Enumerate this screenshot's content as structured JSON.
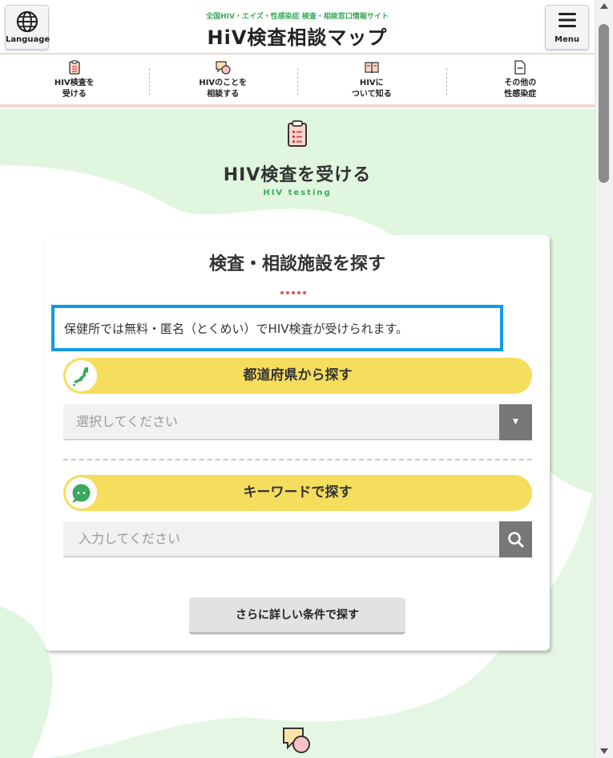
{
  "header": {
    "tagline": "全国HIV・エイズ・性感染症 検査・相談窓口情報サイト",
    "logo": "HiV検査相談マップ",
    "language_label": "Language",
    "menu_label": "Menu"
  },
  "nav": {
    "items": [
      {
        "label": "HIV検査を\n受ける",
        "icon": "clipboard-icon"
      },
      {
        "label": "HIVのことを\n相談する",
        "icon": "chat-bubble-icon"
      },
      {
        "label": "HIVに\nついて知る",
        "icon": "book-icon"
      },
      {
        "label": "その他の\n性感染症",
        "icon": "document-icon"
      }
    ]
  },
  "section": {
    "title": "HIV検査を受ける",
    "subtitle": "HIV testing"
  },
  "search": {
    "title": "検査・相談施設を探す",
    "notice": "保健所では無料・匿名（とくめい）でHIV検査が受けられます。",
    "by_prefecture_label": "都道府県から探す",
    "select_placeholder": "選択してください",
    "by_keyword_label": "キーワードで探す",
    "keyword_placeholder": "入力してください",
    "more_button": "さらに詳しい条件で探す"
  },
  "colors": {
    "accent_yellow": "#f5dd5e",
    "accent_green": "#3aa85d",
    "highlight_blue": "#109ae6",
    "dot_red": "#e05252"
  }
}
